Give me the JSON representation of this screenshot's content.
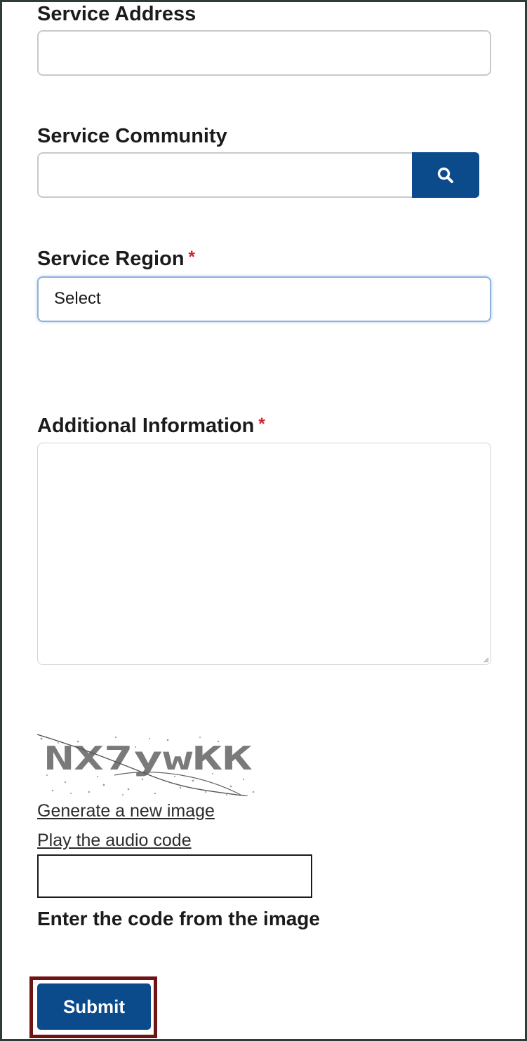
{
  "form": {
    "service_address_label": "Service Address",
    "service_address_value": "",
    "service_community_label": "Service Community",
    "service_community_value": "",
    "service_region_label": "Service Region",
    "service_region_required": "*",
    "service_region_selected": "Select",
    "additional_info_label": "Additional Information",
    "additional_info_required": "*",
    "additional_info_value": ""
  },
  "captcha": {
    "image_code": "NX7ywKK",
    "new_image_link": "Generate a new image",
    "audio_link": "Play the audio code",
    "input_value": "",
    "instruction": "Enter the code from the image"
  },
  "actions": {
    "submit_label": "Submit"
  },
  "colors": {
    "primary_button": "#0b4a8b",
    "required_marker": "#d0212b",
    "highlight_outline": "#6e1414"
  },
  "icons": {
    "search": "search-icon"
  }
}
